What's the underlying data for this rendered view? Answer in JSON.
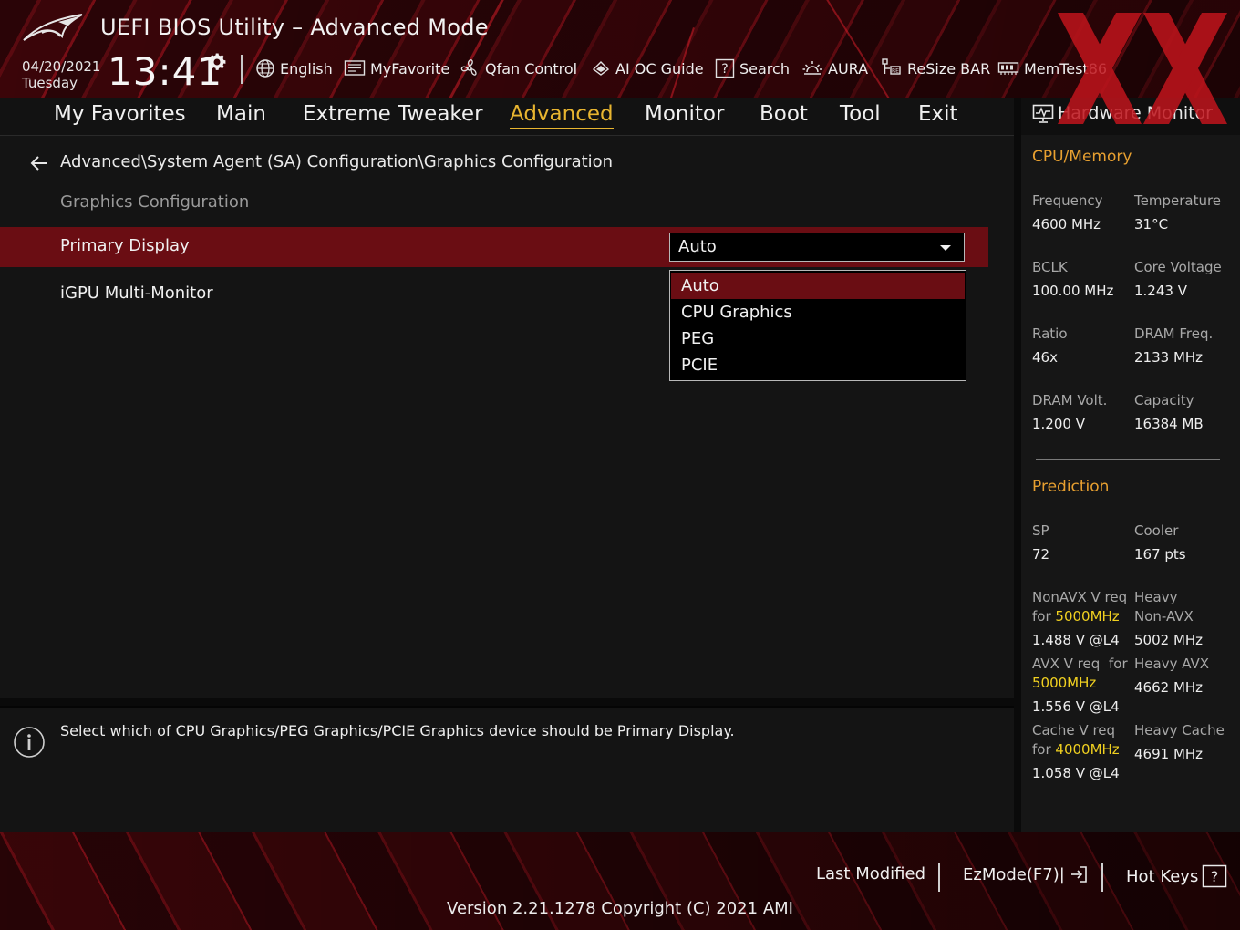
{
  "header": {
    "title": "UEFI BIOS Utility – Advanced Mode",
    "date": "04/20/2021",
    "day": "Tuesday",
    "time": "13:41",
    "toolbar": {
      "language": "English",
      "my_favorite": "MyFavorite",
      "qfan": "Qfan Control",
      "ai_oc": "AI OC Guide",
      "search": "Search",
      "aura": "AURA",
      "resize_bar": "ReSize BAR",
      "memtest": "MemTest86"
    }
  },
  "tabs": {
    "my_favorites": "My Favorites",
    "main": "Main",
    "extreme_tweaker": "Extreme Tweaker",
    "advanced": "Advanced",
    "monitor": "Monitor",
    "boot": "Boot",
    "tool": "Tool",
    "exit": "Exit",
    "active": "Advanced"
  },
  "main": {
    "breadcrumb": "Advanced\\System Agent (SA) Configuration\\Graphics Configuration",
    "section_label": "Graphics Configuration",
    "primary_display": {
      "label": "Primary Display",
      "value": "Auto",
      "options": [
        "Auto",
        "CPU Graphics",
        "PEG",
        "PCIE"
      ],
      "selected_option": "Auto"
    },
    "igpu_multi_monitor": {
      "label": "iGPU Multi-Monitor"
    }
  },
  "info": {
    "text": "Select which of CPU Graphics/PEG Graphics/PCIE Graphics device should be Primary Display."
  },
  "hw_monitor": {
    "title": "Hardware Monitor",
    "cpu_memory": {
      "heading": "CPU/Memory",
      "frequency_label": "Frequency",
      "frequency": "4600 MHz",
      "temperature_label": "Temperature",
      "temperature": "31°C",
      "bclk_label": "BCLK",
      "bclk": "100.00 MHz",
      "core_voltage_label": "Core Voltage",
      "core_voltage": "1.243 V",
      "ratio_label": "Ratio",
      "ratio": "46x",
      "dram_freq_label": "DRAM Freq.",
      "dram_freq": "2133 MHz",
      "dram_volt_label": "DRAM Volt.",
      "dram_volt": "1.200 V",
      "capacity_label": "Capacity",
      "capacity": "16384 MB"
    },
    "prediction": {
      "heading": "Prediction",
      "sp_label": "SP",
      "sp": "72",
      "cooler_label": "Cooler",
      "cooler": "167 pts",
      "nonavx_label_1": "NonAVX V req",
      "nonavx_for": "for",
      "nonavx_freq": "5000MHz",
      "nonavx_value": "1.488 V @L4",
      "heavy_nonavx_label_1": "Heavy",
      "heavy_nonavx_label_2": "Non-AVX",
      "heavy_nonavx_value": "5002 MHz",
      "avx_label_1": "AVX V req",
      "avx_for": "for",
      "avx_freq": "5000MHz",
      "avx_value": "1.556 V @L4",
      "heavy_avx_label": "Heavy AVX",
      "heavy_avx_value": "4662 MHz",
      "cache_label_1": "Cache V req",
      "cache_for": "for",
      "cache_freq": "4000MHz",
      "cache_value": "1.058 V @L4",
      "heavy_cache_label": "Heavy Cache",
      "heavy_cache_value": "4691 MHz"
    }
  },
  "footer": {
    "last_modified": "Last Modified",
    "ezmode": "EzMode(F7)|",
    "hot_keys": "Hot Keys",
    "version": "Version 2.21.1278 Copyright (C) 2021 AMI"
  },
  "colors": {
    "accent": "#e8b530",
    "selected_row": "#6a0d13",
    "section_heading": "#e8a030",
    "highlight_freq": "#f0d020",
    "header_red": "#3a0508"
  },
  "icons": [
    "rog-logo-icon",
    "gear-icon",
    "globe-icon",
    "favorite-icon",
    "fan-icon",
    "ai-chip-icon",
    "search-icon",
    "aura-icon",
    "resize-bar-icon",
    "memtest-icon",
    "back-arrow-icon",
    "chevron-down-icon",
    "info-icon",
    "monitor-icon",
    "exit-arrow-icon",
    "question-icon",
    "xx-watermark"
  ]
}
